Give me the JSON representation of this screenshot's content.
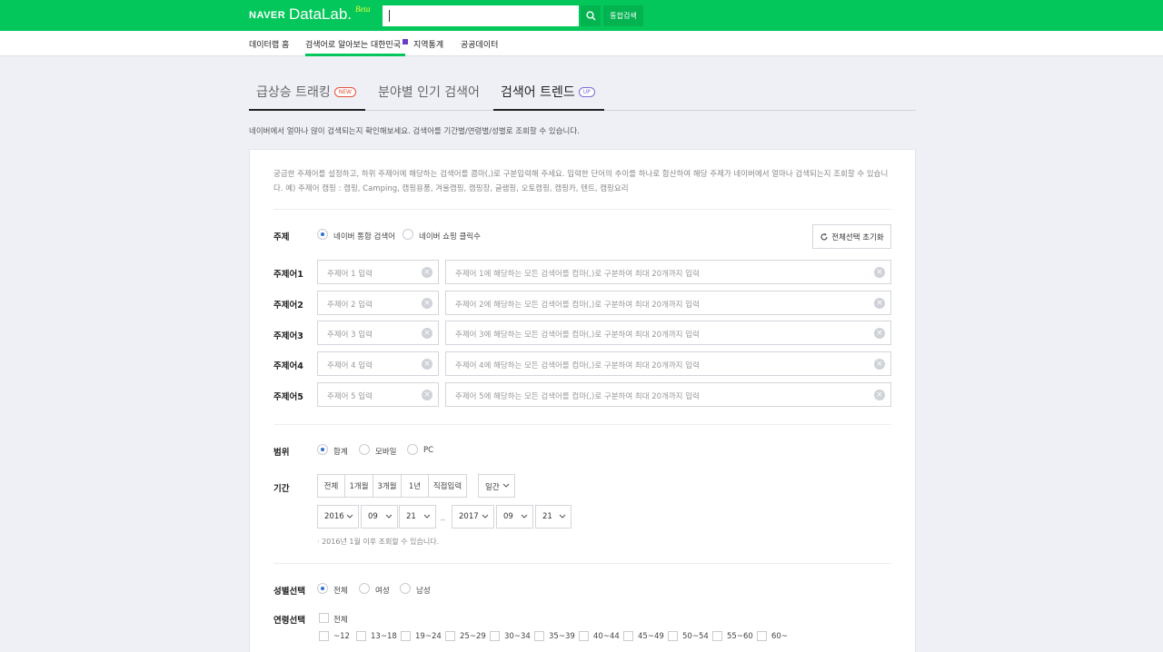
{
  "header": {
    "brand": "NAVER",
    "app": "DataLab.",
    "beta": "Beta",
    "search_value": "",
    "total_search_label": "통합검색",
    "brand_color": "#03c75a"
  },
  "subnav": [
    {
      "label": "데이터랩 홈",
      "active": false
    },
    {
      "label": "검색어로 알아보는 대한민국",
      "active": true,
      "badge": "N"
    },
    {
      "label": "지역통계",
      "active": false
    },
    {
      "label": "공공데이터",
      "active": false
    }
  ],
  "tabs": [
    {
      "label": "급상승 트래킹",
      "pill": "NEW",
      "active": false
    },
    {
      "label": "분야별 인기 검색어",
      "active": false
    },
    {
      "label": "검색어 트렌드",
      "pill": "UP",
      "active": true
    }
  ],
  "intro": "네이버에서 얼마나 많이 검색되는지 확인해보세요. 검색어를 기간별/연령별/성별로 조회할 수 있습니다.",
  "description": "궁금한 주제어를 설정하고, 하위 주제어에 해당하는 검색어를 콤마(,)로 구분입력해 주세요. 입력한 단어의 추이를 하나로 합산하여 해당 주제가 네이버에서 얼마나 검색되는지 조회할 수 있습니다. 예) 주제어 캠핑 : 캠핑, Camping, 캠핑용품, 겨울캠핑, 캠핑장, 글램핑, 오토캠핑, 캠핑카, 텐트, 캠핑요리",
  "topic": {
    "label": "주제",
    "options": [
      {
        "label": "네이버 통합 검색어",
        "selected": true
      },
      {
        "label": "네이버 쇼핑 클릭수",
        "selected": false
      }
    ],
    "reset_label": "전체선택 초기화"
  },
  "keywords": [
    {
      "label": "주제어1",
      "topic_placeholder": "주제어 1 입력",
      "terms_placeholder": "주제어 1에 해당하는 모든 검색어를 컴마(,)로 구분하여 최대 20개까지 입력"
    },
    {
      "label": "주제어2",
      "topic_placeholder": "주제어 2 입력",
      "terms_placeholder": "주제어 2에 해당하는 모든 검색어를 컴마(,)로 구분하여 최대 20개까지 입력"
    },
    {
      "label": "주제어3",
      "topic_placeholder": "주제어 3 입력",
      "terms_placeholder": "주제어 3에 해당하는 모든 검색어를 컴마(,)로 구분하여 최대 20개까지 입력"
    },
    {
      "label": "주제어4",
      "topic_placeholder": "주제어 4 입력",
      "terms_placeholder": "주제어 4에 해당하는 모든 검색어를 컴마(,)로 구분하여 최대 20개까지 입력"
    },
    {
      "label": "주제어5",
      "topic_placeholder": "주제어 5 입력",
      "terms_placeholder": "주제어 5에 해당하는 모든 검색어를 컴마(,)로 구분하여 최대 20개까지 입력"
    }
  ],
  "range": {
    "label": "범위",
    "options": [
      {
        "label": "합계",
        "selected": true
      },
      {
        "label": "모바일",
        "selected": false
      },
      {
        "label": "PC",
        "selected": false
      }
    ]
  },
  "period": {
    "label": "기간",
    "buttons": [
      "전체",
      "1개월",
      "3개월",
      "1년",
      "직접입력"
    ],
    "interval": "일간",
    "start": {
      "year": "2016",
      "month": "09",
      "day": "21"
    },
    "end": {
      "year": "2017",
      "month": "09",
      "day": "21"
    },
    "separator": "~",
    "note": "· 2016년 1월 이후 조회할 수 있습니다."
  },
  "gender": {
    "label": "성별선택",
    "options": [
      {
        "label": "전체",
        "selected": true
      },
      {
        "label": "여성",
        "selected": false
      },
      {
        "label": "남성",
        "selected": false
      }
    ]
  },
  "age": {
    "label": "연령선택",
    "all_label": "전체",
    "options": [
      "~12",
      "13~18",
      "19~24",
      "25~29",
      "30~34",
      "35~39",
      "40~44",
      "45~49",
      "50~54",
      "55~60",
      "60~"
    ]
  }
}
